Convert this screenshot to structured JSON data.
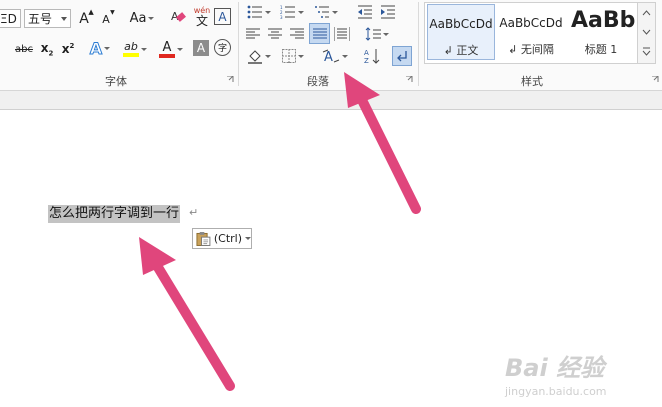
{
  "ribbon": {
    "font_group": {
      "label": "字体",
      "font_name_partial": "ΞD",
      "font_size": "五号",
      "grow_font": "A",
      "shrink_font": "A",
      "change_case": "Aa",
      "phonetic_top": "wén",
      "phonetic_bottom": "文",
      "char_border": "A",
      "strikethrough": "abc",
      "subscript_base": "x",
      "subscript_mark": "2",
      "superscript_base": "x",
      "superscript_mark": "2",
      "text_effects": "A",
      "highlight": "ab",
      "font_color": "A",
      "char_shading": "A",
      "enclose_char": "字"
    },
    "paragraph_group": {
      "label": "段落"
    },
    "styles_group": {
      "label": "样式",
      "items": [
        {
          "sample": "AaBbCcDd",
          "name": "↲ 正文"
        },
        {
          "sample": "AaBbCcDd",
          "name": "↲ 无间隔"
        },
        {
          "sample": "AaBb",
          "name": "标题 1"
        }
      ]
    }
  },
  "colors": {
    "highlight": "#ffff00",
    "font_color": "#e0281f",
    "arrow": "#e0467c",
    "accent": "#2b579a"
  },
  "document": {
    "text": "怎么把两行字调到一行",
    "para_mark": "↵",
    "paste_label": "(Ctrl)"
  },
  "watermark": {
    "logo": "Bai 经验",
    "url": "jingyan.baidu.com"
  }
}
